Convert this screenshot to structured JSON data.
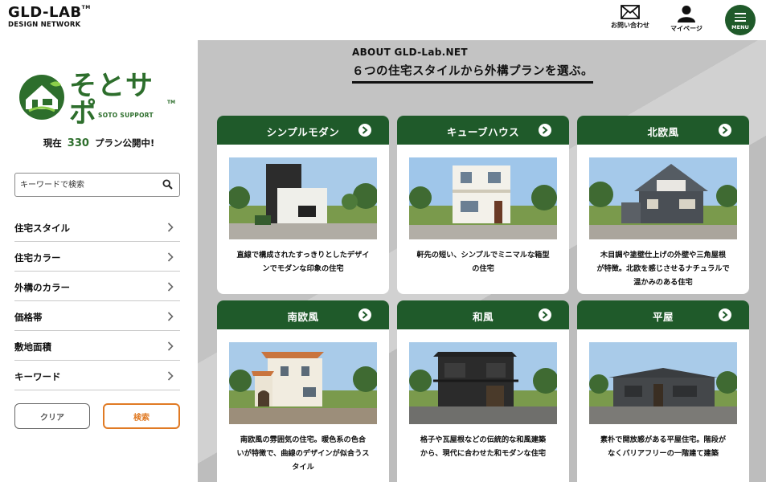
{
  "header": {
    "logo_main": "GLD-LAB",
    "logo_tm": "TM",
    "logo_sub": "DESIGN NETWORK",
    "contact_label": "お問い合わせ",
    "mypage_label": "マイページ",
    "menu_label": "MENU"
  },
  "sidebar": {
    "brand_name": "そとサポ",
    "brand_tm": "TM",
    "brand_sub": "SOTO SUPPORT",
    "count_prefix": "現在",
    "count_value": "330",
    "count_suffix": "プラン公開中!",
    "search_placeholder": "キーワードで検索",
    "filters": [
      {
        "label": "住宅スタイル"
      },
      {
        "label": "住宅カラー"
      },
      {
        "label": "外構のカラー"
      },
      {
        "label": "価格帯"
      },
      {
        "label": "敷地面積"
      },
      {
        "label": "キーワード"
      }
    ],
    "clear_label": "クリア",
    "search_label": "検索"
  },
  "main": {
    "about": "ABOUT GLD-Lab.NET",
    "title": "６つの住宅スタイルから外構プランを選ぶ。",
    "cards": [
      {
        "name": "シンプルモダン",
        "line1": "直線で構成されたすっきりとしたデザイ",
        "line2": "ンでモダンな印象の住宅",
        "line3": ""
      },
      {
        "name": "キューブハウス",
        "line1": "軒先の短い、シンプルでミニマルな箱型",
        "line2": "の住宅",
        "line3": ""
      },
      {
        "name": "北欧風",
        "line1": "木目調や塗壁仕上げの外壁や三角屋根",
        "line2": "が特徴。北欧を感じさせるナチュラルで",
        "line3": "温かみのある住宅"
      },
      {
        "name": "南欧風",
        "line1": "南欧風の雰囲気の住宅。暖色系の色合",
        "line2": "いが特徴で、曲線のデザインが似合うス",
        "line3": "タイル"
      },
      {
        "name": "和風",
        "line1": "格子や瓦屋根などの伝統的な和風建築",
        "line2": "から、現代に合わせた和モダンな住宅",
        "line3": ""
      },
      {
        "name": "平屋",
        "line1": "素朴で開放感がある平屋住宅。階段が",
        "line2": "なくバリアフリーの一階建て建築",
        "line3": ""
      }
    ]
  },
  "colors": {
    "brand_green": "#1f5a2a",
    "accent_orange": "#e07a24"
  }
}
